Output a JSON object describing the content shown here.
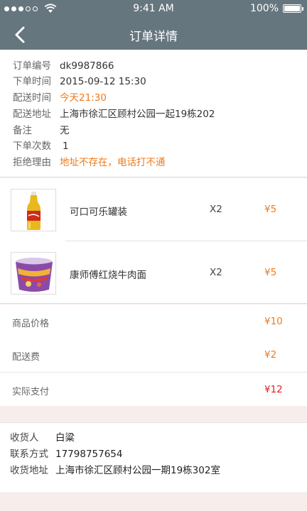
{
  "status_bar": {
    "time": "9:41 AM",
    "battery": "100%"
  },
  "nav": {
    "title": "订单详情",
    "back_icon": "chevron-left-icon"
  },
  "order_info": {
    "rows": [
      {
        "label": "订单编号",
        "value": "dk9987866"
      },
      {
        "label": "下单时间",
        "value": "2015-09-12  15:30"
      },
      {
        "label": "配送时间",
        "value": "今天21:30"
      },
      {
        "label": "配送地址",
        "value": "上海市徐汇区顾村公园一起19栋202"
      },
      {
        "label": "备注",
        "value": "无"
      },
      {
        "label": "下单次数",
        "value": "1"
      },
      {
        "label": "拒绝理由",
        "value": "地址不存在，电话打不通"
      }
    ]
  },
  "products": [
    {
      "name": "可口可乐罐装",
      "qty": "X2",
      "price": "¥5"
    },
    {
      "name": "康师傅红烧牛肉面",
      "qty": "X2",
      "price": "¥5"
    }
  ],
  "price_summary": {
    "goods_label": "商品价格",
    "goods_value": "¥10",
    "delivery_label": "配送费",
    "delivery_value": "¥2",
    "paid_label": "实际支付",
    "paid_value": "¥12"
  },
  "consignee": {
    "name_label": "收货人",
    "name": "白粱",
    "phone_label": "联系方式",
    "phone": "17798757654",
    "address_label": "收货地址",
    "address": "上海市徐汇区顾村公园一期19栋302室"
  },
  "colors": {
    "nav_bg": "#66767f",
    "accent_orange": "#f07a1a",
    "accent_red": "#e02020",
    "page_bg": "#f7eeec"
  }
}
